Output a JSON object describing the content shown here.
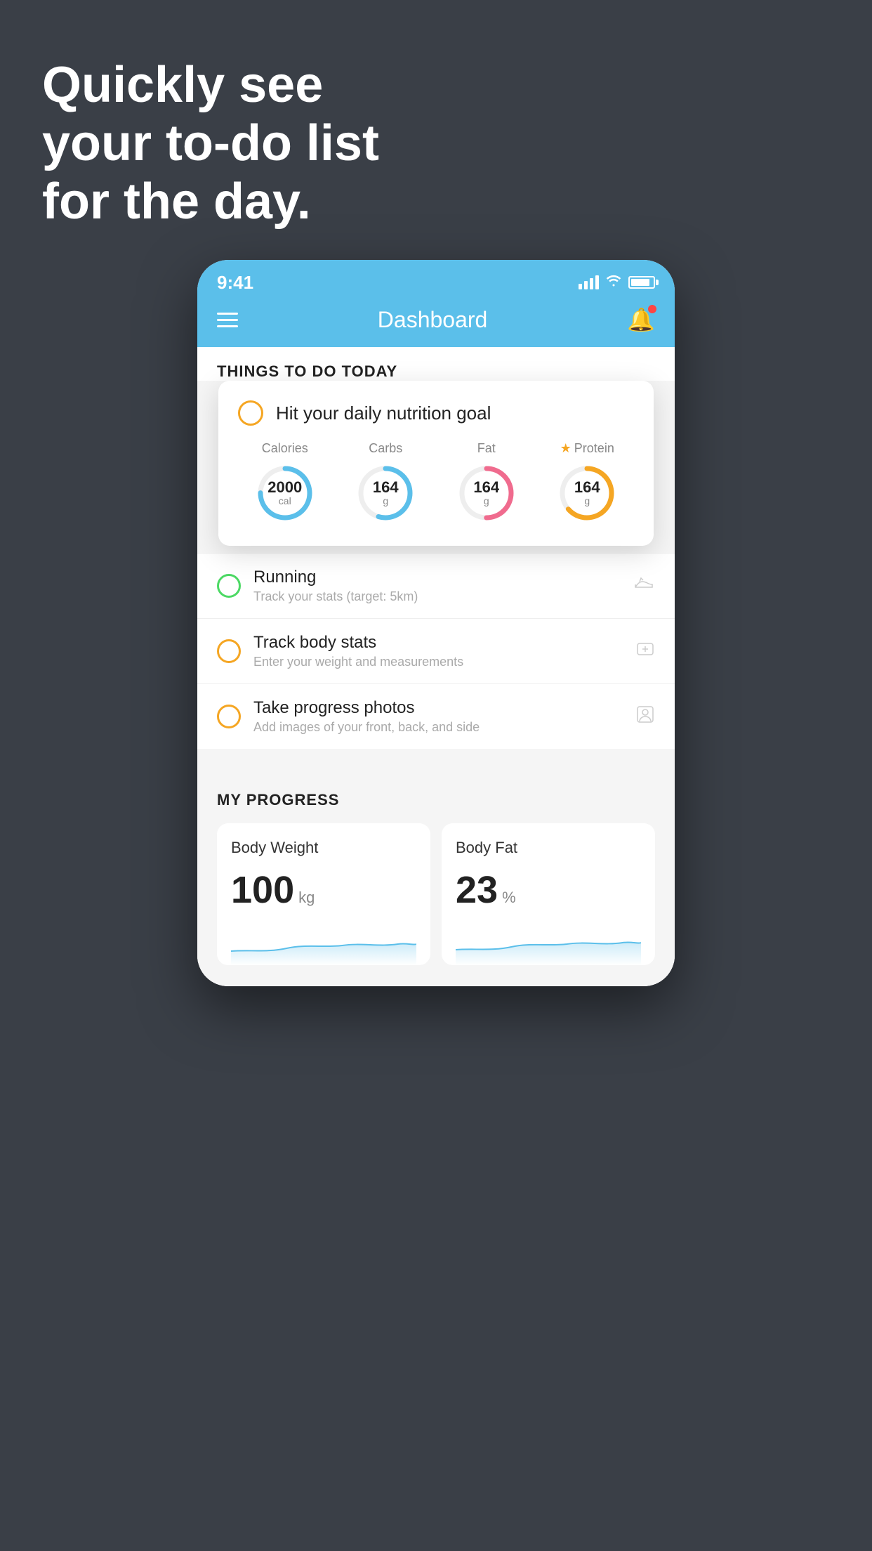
{
  "background": {
    "headline_line1": "Quickly see",
    "headline_line2": "your to-do list",
    "headline_line3": "for the day.",
    "bg_color": "#3a3f47"
  },
  "phone": {
    "status_bar": {
      "time": "9:41",
      "signal_bars": 4,
      "wifi": true,
      "battery": 85
    },
    "header": {
      "title": "Dashboard",
      "menu_label": "menu",
      "bell_label": "notifications"
    },
    "things_section": {
      "title": "THINGS TO DO TODAY"
    },
    "floating_card": {
      "title": "Hit your daily nutrition goal",
      "nutrition": {
        "calories": {
          "label": "Calories",
          "value": "2000",
          "unit": "cal",
          "color": "#5bbfea"
        },
        "carbs": {
          "label": "Carbs",
          "value": "164",
          "unit": "g",
          "color": "#5bbfea"
        },
        "fat": {
          "label": "Fat",
          "value": "164",
          "unit": "g",
          "color": "#f06b8e"
        },
        "protein": {
          "label": "Protein",
          "value": "164",
          "unit": "g",
          "color": "#f5a623",
          "starred": true
        }
      }
    },
    "todo_items": [
      {
        "id": "running",
        "title": "Running",
        "subtitle": "Track your stats (target: 5km)",
        "circle_color": "green",
        "icon": "shoe"
      },
      {
        "id": "track-body",
        "title": "Track body stats",
        "subtitle": "Enter your weight and measurements",
        "circle_color": "yellow",
        "icon": "scale"
      },
      {
        "id": "progress-photos",
        "title": "Take progress photos",
        "subtitle": "Add images of your front, back, and side",
        "circle_color": "yellow",
        "icon": "person"
      }
    ],
    "progress_section": {
      "title": "MY PROGRESS",
      "cards": [
        {
          "id": "body-weight",
          "title": "Body Weight",
          "value": "100",
          "unit": "kg"
        },
        {
          "id": "body-fat",
          "title": "Body Fat",
          "value": "23",
          "unit": "%"
        }
      ]
    }
  }
}
